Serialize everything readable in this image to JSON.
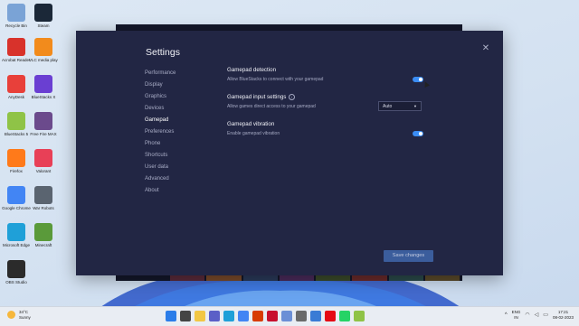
{
  "desktop": {
    "icons": [
      {
        "label": "Recycle Bin",
        "color": "#7aa3d6"
      },
      {
        "label": "Acrobat Reader DC",
        "color": "#d8322b"
      },
      {
        "label": "AnyDesk",
        "color": "#e8403a"
      },
      {
        "label": "BlueStacks 5",
        "color": "#8fc347"
      },
      {
        "label": "Firefox",
        "color": "#ff7a1a"
      },
      {
        "label": "Google Chrome",
        "color": "#4285f4"
      },
      {
        "label": "Microsoft Edge",
        "color": "#1fa0d8"
      },
      {
        "label": "OBS Studio",
        "color": "#2b2b2b"
      },
      {
        "label": "Steam",
        "color": "#1b2838"
      },
      {
        "label": "VLC media player",
        "color": "#f28b1c"
      },
      {
        "label": "BlueStacks X",
        "color": "#6a3fd2"
      },
      {
        "label": "Free Fire MAX",
        "color": "#6b4a8c"
      },
      {
        "label": "Valorant",
        "color": "#e84057"
      },
      {
        "label": "War Robots",
        "color": "#5a6470"
      },
      {
        "label": "Minecraft",
        "color": "#5a9a3a"
      }
    ]
  },
  "dialog": {
    "title": "Settings",
    "close_symbol": "✕",
    "nav": [
      {
        "label": "Performance"
      },
      {
        "label": "Display"
      },
      {
        "label": "Graphics"
      },
      {
        "label": "Devices"
      },
      {
        "label": "Gamepad"
      },
      {
        "label": "Preferences"
      },
      {
        "label": "Phone"
      },
      {
        "label": "Shortcuts"
      },
      {
        "label": "User data"
      },
      {
        "label": "Advanced"
      },
      {
        "label": "About"
      }
    ],
    "active_nav": "Gamepad",
    "sections": {
      "detection": {
        "title": "Gamepad detection",
        "desc": "Allow BlueStacks to connect with your gamepad",
        "enabled": true
      },
      "input": {
        "title": "Gamepad input settings",
        "desc": "Allow games direct access to your gamepad",
        "select_value": "Auto"
      },
      "vibration": {
        "title": "Gamepad vibration",
        "desc": "Enable gamepad vibration",
        "enabled": true
      }
    },
    "save_label": "Save changes",
    "accent_color": "#3b8df5"
  },
  "taskbar": {
    "weather_temp": "34°C",
    "weather_desc": "Sunny",
    "lang_line1": "ENG",
    "lang_line2": "IN",
    "time": "17:21",
    "date": "08-02-2023",
    "pinned_icons": [
      "windows-start-icon",
      "search-icon",
      "file-explorer-icon",
      "chat-icon",
      "edge-icon",
      "chrome-icon",
      "office-icon",
      "mcafee-icon",
      "photos-icon",
      "settings-icon",
      "store-icon",
      "netflix-icon",
      "whatsapp-icon",
      "bluestacks-icon"
    ]
  }
}
